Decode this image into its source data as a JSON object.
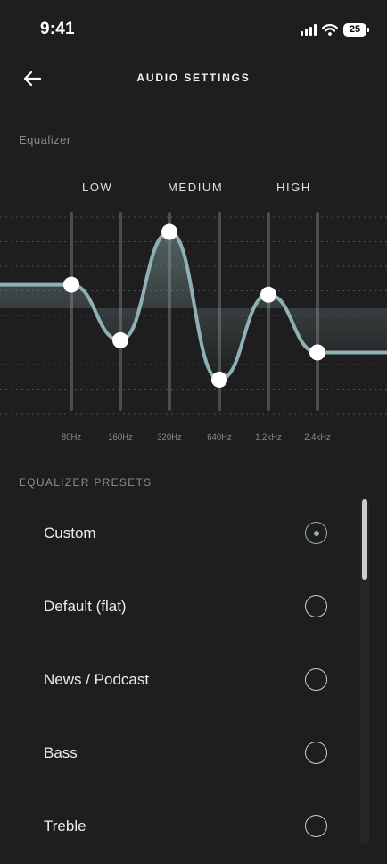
{
  "status_bar": {
    "time": "9:41",
    "battery": "25"
  },
  "header": {
    "title": "AUDIO SETTINGS"
  },
  "equalizer": {
    "label": "Equalizer",
    "bands": [
      "LOW",
      "MEDIUM",
      "HIGH"
    ],
    "frequencies": [
      "80Hz",
      "160Hz",
      "320Hz",
      "640Hz",
      "1,2kHz",
      "2,4kHz"
    ],
    "levels": [
      0.634,
      0.355,
      0.899,
      0.157,
      0.584,
      0.294
    ],
    "accent_color": "#8fb0b4"
  },
  "presets": {
    "label": "EQUALIZER PRESETS",
    "items": [
      {
        "label": "Custom",
        "selected": true
      },
      {
        "label": "Default (flat)",
        "selected": false
      },
      {
        "label": "News / Podcast",
        "selected": false
      },
      {
        "label": "Bass",
        "selected": false
      },
      {
        "label": "Treble",
        "selected": false
      }
    ]
  },
  "icons": {
    "back": "arrow-left-icon",
    "signal": "signal-bars-icon",
    "wifi": "wifi-icon",
    "battery": "battery-icon",
    "radio": "radio-button-icon"
  }
}
